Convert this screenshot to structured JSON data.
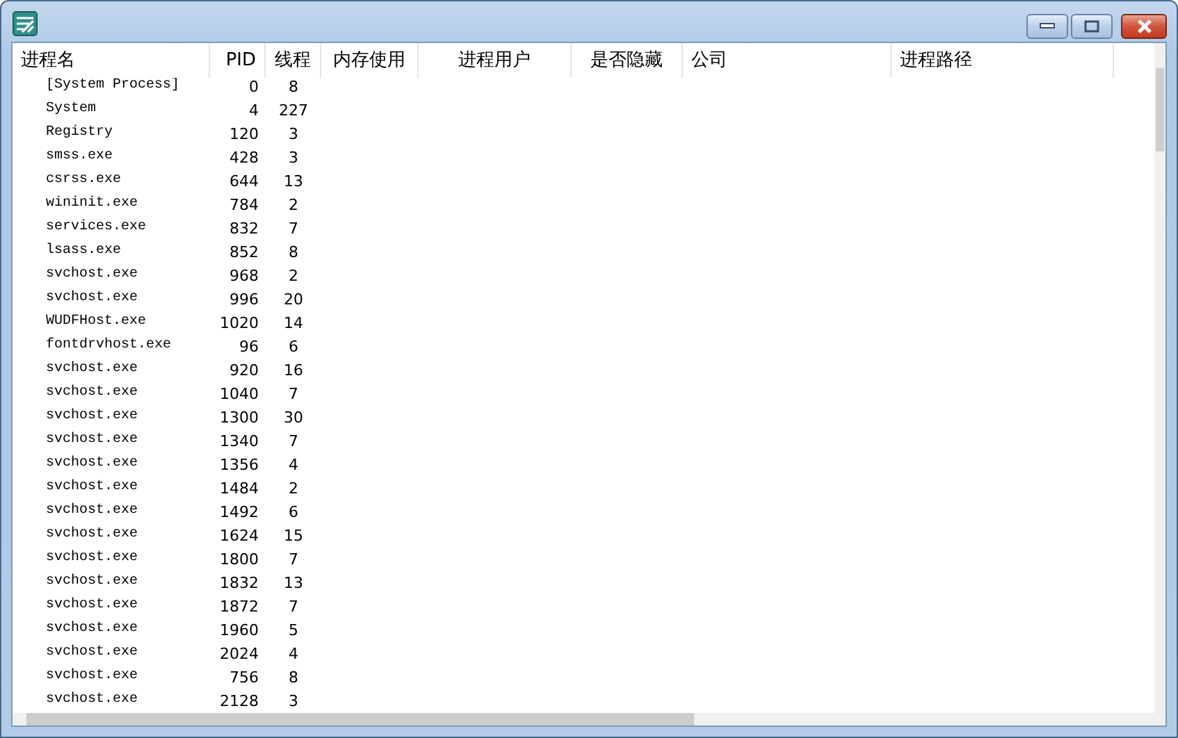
{
  "table": {
    "columns": [
      "进程名",
      "PID",
      "线程",
      "内存使用",
      "进程用户",
      "是否隐藏",
      "公司",
      "进程路径"
    ],
    "rows": [
      [
        "[System Process]",
        "0",
        "8"
      ],
      [
        "System",
        "4",
        "227"
      ],
      [
        "Registry",
        "120",
        "3"
      ],
      [
        "smss.exe",
        "428",
        "3"
      ],
      [
        "csrss.exe",
        "644",
        "13"
      ],
      [
        "wininit.exe",
        "784",
        "2"
      ],
      [
        "services.exe",
        "832",
        "7"
      ],
      [
        "lsass.exe",
        "852",
        "8"
      ],
      [
        "svchost.exe",
        "968",
        "2"
      ],
      [
        "svchost.exe",
        "996",
        "20"
      ],
      [
        "WUDFHost.exe",
        "1020",
        "14"
      ],
      [
        "fontdrvhost.exe",
        "96",
        "6"
      ],
      [
        "svchost.exe",
        "920",
        "16"
      ],
      [
        "svchost.exe",
        "1040",
        "7"
      ],
      [
        "svchost.exe",
        "1300",
        "30"
      ],
      [
        "svchost.exe",
        "1340",
        "7"
      ],
      [
        "svchost.exe",
        "1356",
        "4"
      ],
      [
        "svchost.exe",
        "1484",
        "2"
      ],
      [
        "svchost.exe",
        "1492",
        "6"
      ],
      [
        "svchost.exe",
        "1624",
        "15"
      ],
      [
        "svchost.exe",
        "1800",
        "7"
      ],
      [
        "svchost.exe",
        "1832",
        "13"
      ],
      [
        "svchost.exe",
        "1872",
        "7"
      ],
      [
        "svchost.exe",
        "1960",
        "5"
      ],
      [
        "svchost.exe",
        "2024",
        "4"
      ],
      [
        "svchost.exe",
        "756",
        "8"
      ],
      [
        "svchost.exe",
        "2128",
        "3"
      ]
    ]
  }
}
